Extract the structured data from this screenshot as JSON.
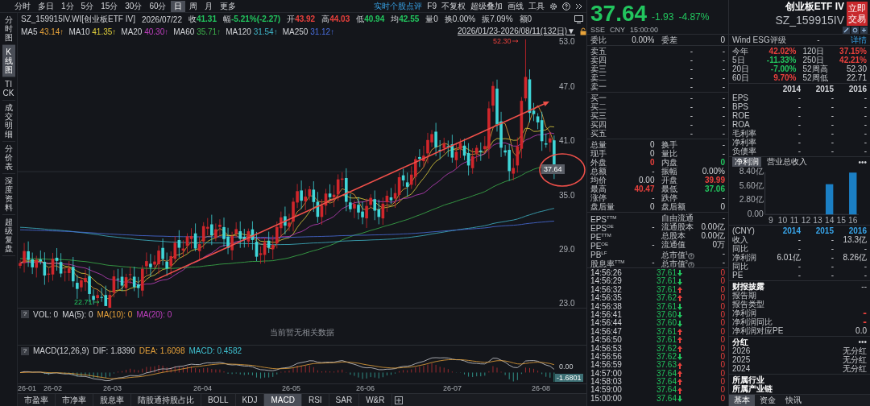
{
  "period_tabs": [
    {
      "label": "分时",
      "selected": false
    },
    {
      "label": "多日",
      "selected": false
    },
    {
      "label": "1分",
      "selected": false
    },
    {
      "label": "5分",
      "selected": false
    },
    {
      "label": "15分",
      "selected": false
    },
    {
      "label": "30分",
      "selected": false
    },
    {
      "label": "60分",
      "selected": false
    },
    {
      "label": "日",
      "selected": true
    },
    {
      "label": "周",
      "selected": false
    },
    {
      "label": "月",
      "selected": false
    },
    {
      "label": "更多",
      "selected": false
    }
  ],
  "toolbar": {
    "link": "实时个股点评",
    "items": [
      "F9",
      "不复权",
      "超级叠加",
      "画线",
      "工具"
    ]
  },
  "sidebar": [
    {
      "label": "分时图",
      "selected": false
    },
    {
      "label": "K线图",
      "selected": true
    },
    {
      "label": "TICK",
      "selected": false
    },
    {
      "label": "成交明细",
      "selected": false
    },
    {
      "label": "分价表",
      "selected": false
    },
    {
      "label": "深度资料",
      "selected": false
    },
    {
      "label": "超级复盘",
      "selected": false
    }
  ],
  "info_bar": {
    "symbol": "SZ_159915IV.WI[创业板ETF IV]",
    "date": "2026/07/22",
    "fields": [
      {
        "label": "收",
        "value": "41.31",
        "color": "#22c55e"
      },
      {
        "label": "幅",
        "value": "-5.21%(-2.27)",
        "color": "#22c55e"
      },
      {
        "label": "开",
        "value": "43.92",
        "color": "#e8403c"
      },
      {
        "label": "高",
        "value": "44.03",
        "color": "#e8403c"
      },
      {
        "label": "低",
        "value": "40.94",
        "color": "#22c55e"
      },
      {
        "label": "均",
        "value": "42.55",
        "color": "#22c55e"
      },
      {
        "label": "量",
        "value": "0"
      },
      {
        "label": "换",
        "value": "0.00%"
      },
      {
        "label": "振",
        "value": "7.09%"
      },
      {
        "label": "额",
        "value": "0"
      }
    ]
  },
  "ma_legend": {
    "items": [
      {
        "name": "MA5",
        "value": "43.14↑",
        "color": "#e8a33a"
      },
      {
        "name": "MA10",
        "value": "41.35↑",
        "color": "#e3d23c"
      },
      {
        "name": "MA20",
        "value": "40.30↑",
        "color": "#c040c0"
      },
      {
        "name": "MA60",
        "value": "35.71↑",
        "color": "#3cb44b"
      },
      {
        "name": "MA120",
        "value": "31.54↑",
        "color": "#3fb5c8"
      },
      {
        "name": "MA250",
        "value": "31.12↑",
        "color": "#4a6fe0"
      }
    ],
    "range": "2026/01/23-2026/08/11(132日)▼"
  },
  "price_chart": {
    "yticks": [
      "53.0",
      "47.0",
      "41.0",
      "35.0",
      "29.0",
      "23.0"
    ],
    "high_label": "52.30",
    "low_label": "22.71",
    "last_price": "37.64"
  },
  "volume_panel": {
    "help": "?",
    "fields": [
      {
        "text": "VOL: 0",
        "color": "#d2d4d8"
      },
      {
        "text": "MA(5): 0",
        "color": "#d2d4d8"
      },
      {
        "text": "MA(10): 0",
        "color": "#e8a33a"
      },
      {
        "text": "MA(20): 0",
        "color": "#c040c0"
      }
    ],
    "empty_text": "当前暂无相关数据"
  },
  "macd_panel": {
    "help": "?",
    "fields": [
      {
        "text": "MACD(12,26,9)",
        "color": "#d2d4d8"
      },
      {
        "text": "DIF: 1.8390",
        "color": "#d2d4d8"
      },
      {
        "text": "DEA: 1.6098",
        "color": "#e8a33a"
      },
      {
        "text": "MACD: 0.4582",
        "color": "#3fc1d0"
      }
    ],
    "zero_label": "0.00",
    "last_label": "-1.6801"
  },
  "x_axis": [
    "26-01",
    "26-02",
    "26-03",
    "26-04",
    "26-05",
    "26-06",
    "26-07",
    "26-08"
  ],
  "indicator_tabs": [
    {
      "label": "市盈率",
      "selected": false
    },
    {
      "label": "市净率",
      "selected": false
    },
    {
      "label": "股息率",
      "selected": false
    },
    {
      "label": "陆股通持股占比",
      "selected": false
    },
    {
      "label": "BOLL",
      "selected": false
    },
    {
      "label": "KDJ",
      "selected": false
    },
    {
      "label": "MACD",
      "selected": true
    },
    {
      "label": "RSI",
      "selected": false
    },
    {
      "label": "SAR",
      "selected": false
    },
    {
      "label": "W&R",
      "selected": false
    }
  ],
  "quote": {
    "price": "37.64",
    "change": "-1.93",
    "change_pct": "-4.87%",
    "color": "#22c55e",
    "meta": [
      "SSE",
      "CNY",
      "15:00:00"
    ]
  },
  "order_book": {
    "ratio_label": "委比",
    "ratio": "0.00%",
    "diff_label": "委差",
    "diff": "0",
    "asks": [
      {
        "label": "卖五",
        "price": "-",
        "volume": "-"
      },
      {
        "label": "卖四",
        "price": "-",
        "volume": "-"
      },
      {
        "label": "卖三",
        "price": "-",
        "volume": "-"
      },
      {
        "label": "卖二",
        "price": "-",
        "volume": "-"
      },
      {
        "label": "卖一",
        "price": "-",
        "volume": "-"
      }
    ],
    "bids": [
      {
        "label": "买一",
        "price": "-",
        "volume": "-"
      },
      {
        "label": "买二",
        "price": "-",
        "volume": "-"
      },
      {
        "label": "买三",
        "price": "-",
        "volume": "-"
      },
      {
        "label": "买四",
        "price": "-",
        "volume": "-"
      },
      {
        "label": "买五",
        "price": "-",
        "volume": "-"
      }
    ]
  },
  "stats": [
    [
      {
        "label": "总量",
        "value": "0"
      },
      {
        "label": "换手",
        "value": "-"
      }
    ],
    [
      {
        "label": "现手",
        "value": "0"
      },
      {
        "label": "量比",
        "value": "-"
      }
    ],
    [
      {
        "label": "外盘",
        "value": "0",
        "color": "#e8403c"
      },
      {
        "label": "内盘",
        "value": "0",
        "color": "#22c55e"
      }
    ],
    [
      {
        "label": "总额",
        "value": "-"
      },
      {
        "label": "振幅",
        "value": "0.00%"
      }
    ],
    [
      {
        "label": "均价",
        "value": "0.00"
      },
      {
        "label": "开盘",
        "value": "39.99",
        "color": "#e8403c"
      }
    ],
    [
      {
        "label": "最高",
        "value": "40.47",
        "color": "#e8403c"
      },
      {
        "label": "最低",
        "value": "37.06",
        "color": "#22c55e"
      }
    ],
    [
      {
        "label": "涨停",
        "value": "-"
      },
      {
        "label": "跌停",
        "value": "-"
      }
    ],
    [
      {
        "label": "盘后量",
        "value": "0"
      },
      {
        "label": "盘后额",
        "value": "0"
      }
    ]
  ],
  "fundamentals": [
    [
      {
        "label": "EPS$^{TTM}$"
      },
      {
        "label": "自由流通",
        "value": "-"
      }
    ],
    [
      {
        "label": "EPS$^{OE}$",
        "value": "-"
      },
      {
        "label": "流通股本",
        "value": "0.00亿"
      }
    ],
    [
      {
        "label": "PE$^{TTM}$"
      },
      {
        "label": "总股本",
        "value": "0.00亿"
      }
    ],
    [
      {
        "label": "PE$^{OE}$",
        "value": "-"
      },
      {
        "label": "流通值",
        "value": "0万"
      }
    ],
    [
      {
        "label": "PB$^{LF}$"
      },
      {
        "label": "总市值$^{1}$",
        "value": "-",
        "hint": true
      }
    ],
    [
      {
        "label": "股息率$^{TTM}$",
        "value": "-"
      },
      {
        "label": "总市值$^{2}$",
        "value": "-",
        "hint": true
      }
    ]
  ],
  "ticks": [
    {
      "time": "14:56:26",
      "price": "37.61",
      "rising": false,
      "volume": "0"
    },
    {
      "time": "14:56:29",
      "price": "37.61",
      "rising": false,
      "volume": "0"
    },
    {
      "time": "14:56:32",
      "price": "37.61",
      "rising": true,
      "volume": "0"
    },
    {
      "time": "14:56:35",
      "price": "37.62",
      "rising": true,
      "volume": "0"
    },
    {
      "time": "14:56:38",
      "price": "37.61",
      "rising": false,
      "volume": "0"
    },
    {
      "time": "14:56:41",
      "price": "37.60",
      "rising": false,
      "volume": "0"
    },
    {
      "time": "14:56:44",
      "price": "37.60",
      "rising": false,
      "volume": "0"
    },
    {
      "time": "14:56:47",
      "price": "37.61",
      "rising": true,
      "volume": "0"
    },
    {
      "time": "14:56:50",
      "price": "37.61",
      "rising": true,
      "volume": "0"
    },
    {
      "time": "14:56:53",
      "price": "37.62",
      "rising": true,
      "volume": "0"
    },
    {
      "time": "14:56:56",
      "price": "37.62",
      "rising": false,
      "volume": "0"
    },
    {
      "time": "14:56:59",
      "price": "37.63",
      "rising": true,
      "volume": "0"
    },
    {
      "time": "14:57:00",
      "price": "37.64",
      "rising": true,
      "volume": "0"
    },
    {
      "time": "14:58:03",
      "price": "37.64",
      "rising": true,
      "volume": "0"
    },
    {
      "time": "14:59:00",
      "price": "37.64",
      "rising": true,
      "volume": "0"
    },
    {
      "time": "15:00:00",
      "price": "37.64",
      "rising": false,
      "volume": "0"
    }
  ],
  "instrument": {
    "name": "创业板ETF IV",
    "code": "SZ_159915IV",
    "trade_button": "立即交易"
  },
  "esg": {
    "label": "Wind ESG评级",
    "value": "-",
    "link": "详情"
  },
  "returns": [
    [
      {
        "label": "今年",
        "value": "42.02%",
        "color": "#e8403c"
      },
      {
        "label": "120日",
        "value": "37.15%",
        "color": "#e8403c"
      }
    ],
    [
      {
        "label": "5日",
        "value": "-11.33%",
        "color": "#22c55e"
      },
      {
        "label": "250日",
        "value": "42.21%",
        "color": "#e8403c"
      }
    ],
    [
      {
        "label": "20日",
        "value": "-7.00%",
        "color": "#22c55e"
      },
      {
        "label": "52周高",
        "value": "52.30"
      }
    ],
    [
      {
        "label": "60日",
        "value": "9.70%",
        "color": "#e8403c"
      },
      {
        "label": "52周低",
        "value": "22.71"
      }
    ]
  ],
  "finance": {
    "years": [
      "2014",
      "2015",
      "2016"
    ],
    "rows": [
      {
        "label": "EPS",
        "values": [
          "-",
          "-",
          "-"
        ]
      },
      {
        "label": "BPS",
        "values": [
          "-",
          "-",
          "-"
        ]
      },
      {
        "label": "ROE",
        "values": [
          "-",
          "-",
          "-"
        ]
      },
      {
        "label": "ROA",
        "values": [
          "-",
          "-",
          "-"
        ]
      },
      {
        "label": "毛利率",
        "values": [
          "-",
          "-",
          "-"
        ]
      },
      {
        "label": "净利率",
        "values": [
          "-",
          "-",
          "-"
        ]
      },
      {
        "label": "负债率",
        "values": [
          "-",
          "-",
          "-"
        ]
      }
    ]
  },
  "profit_chart": {
    "tabs": [
      {
        "label": "净利润",
        "selected": true
      },
      {
        "label": "营业总收入",
        "selected": false
      }
    ],
    "more": "•••",
    "chart_data": {
      "type": "bar",
      "categories": [
        "9",
        "10",
        "11",
        "12",
        "13",
        "14",
        "15",
        "16"
      ],
      "series": [
        {
          "color": "#1b7fc4",
          "values": [
            null,
            null,
            null,
            null,
            null,
            6.0,
            null,
            8.3
          ]
        }
      ],
      "ylim": [
        0,
        8.4
      ],
      "yticks": [
        {
          "value": 0,
          "label": "0.00"
        },
        {
          "value": 2.8,
          "label": "2.80亿"
        },
        {
          "value": 5.6,
          "label": "5.60亿"
        },
        {
          "value": 8.4,
          "label": "8.40亿"
        }
      ]
    }
  },
  "annual": {
    "currency": "(CNY)",
    "years": [
      "2014",
      "2015",
      "2016"
    ],
    "rows": [
      {
        "label": "收入",
        "values": [
          "-",
          "-",
          "13.3亿"
        ]
      },
      {
        "label": "同比",
        "values": [
          "-",
          "-",
          "-"
        ]
      },
      {
        "label": "净利润",
        "values": [
          "6.01亿",
          "-",
          "8.26亿"
        ]
      },
      {
        "label": "同比",
        "values": [
          "-",
          "-",
          "-"
        ]
      },
      {
        "label": "PE",
        "values": [
          "-",
          "-",
          "-"
        ]
      }
    ]
  },
  "disclosure": {
    "title": "财报披露",
    "more": "--",
    "rows": [
      {
        "label": "报告期"
      },
      {
        "label": "报告类型"
      },
      {
        "label": "净利润",
        "value": "-",
        "color": "#e8403c"
      },
      {
        "label": "净利润同比",
        "value": "-",
        "color": "#e8403c"
      },
      {
        "label": "净利润对应PE",
        "value": "0.0"
      }
    ]
  },
  "dividends": {
    "title": "分红",
    "more": "•••",
    "rows": [
      {
        "year": "2026",
        "value": "无分红"
      },
      {
        "year": "2025",
        "value": "无分红"
      },
      {
        "year": "2024",
        "value": "无分红"
      }
    ]
  },
  "industry": [
    "所属行业",
    "所属产业链"
  ],
  "bottom_tabs": [
    {
      "label": "基本",
      "selected": true
    },
    {
      "label": "资金",
      "selected": false
    },
    {
      "label": "快讯",
      "selected": false
    }
  ]
}
